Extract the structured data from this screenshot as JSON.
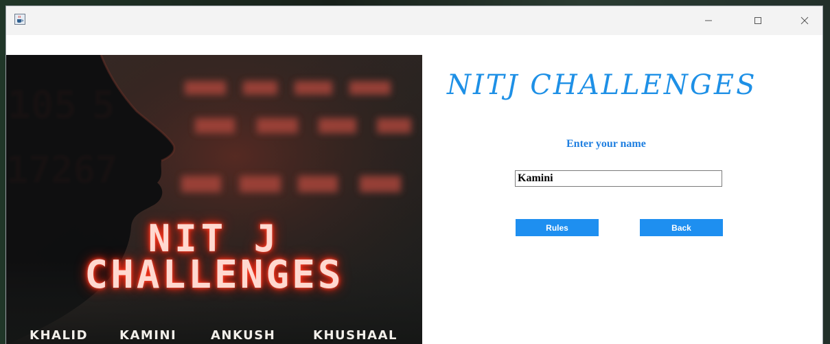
{
  "window": {
    "icon": "java-coffee-icon",
    "controls": [
      "minimize-icon",
      "maximize-icon",
      "close-icon"
    ]
  },
  "poster": {
    "title_line1": "NIT J",
    "title_line2": "CHALLENGES",
    "members": [
      "KHALID",
      "KAMINI",
      "ANKUSH",
      "KHUSHAAL"
    ],
    "numbers": [
      "105",
      "5",
      "17267"
    ]
  },
  "form": {
    "app_title": "NITJ CHALLENGES",
    "name_label": "Enter your name",
    "name_value": "Kamini",
    "rules_label": "Rules",
    "back_label": "Back"
  },
  "colors": {
    "accent": "#1e90e6",
    "button": "#1e8ff0",
    "neon": "#ff3b22"
  }
}
